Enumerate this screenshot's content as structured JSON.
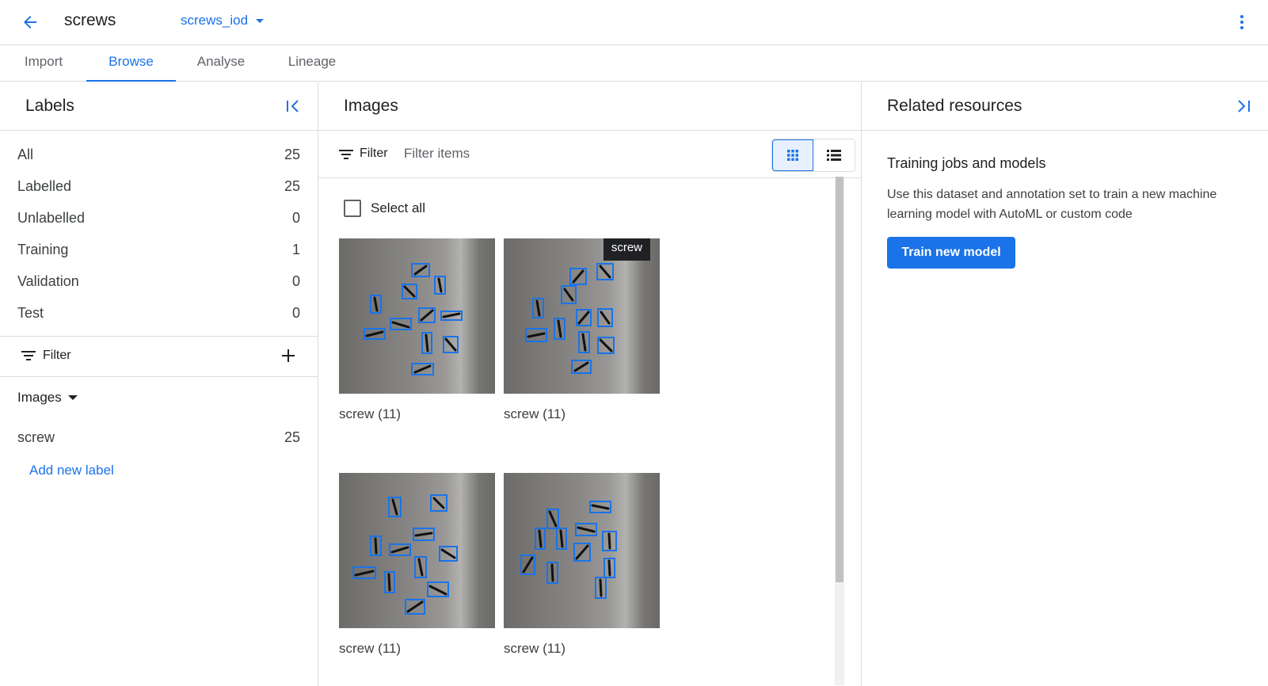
{
  "topbar": {
    "back_icon": "arrow-back-icon",
    "dataset_name": "screws",
    "annotation_set": "screws_iod",
    "more_icon": "more-vert-icon"
  },
  "tabs": [
    {
      "label": "Import",
      "active": false
    },
    {
      "label": "Browse",
      "active": true
    },
    {
      "label": "Analyse",
      "active": false
    },
    {
      "label": "Lineage",
      "active": false
    }
  ],
  "labels_panel": {
    "title": "Labels",
    "collapse_icon": "collapse-left-icon",
    "items": [
      {
        "name": "All",
        "count": "25"
      },
      {
        "name": "Labelled",
        "count": "25"
      },
      {
        "name": "Unlabelled",
        "count": "0"
      },
      {
        "name": "Training",
        "count": "1"
      },
      {
        "name": "Validation",
        "count": "0"
      },
      {
        "name": "Test",
        "count": "0"
      }
    ],
    "filter_label": "Filter",
    "group_label": "Images",
    "label_items": [
      {
        "name": "screw",
        "count": "25"
      }
    ],
    "add_label": "Add new label"
  },
  "images_panel": {
    "title": "Images",
    "filter_label": "Filter",
    "filter_placeholder": "Filter items",
    "select_all": "Select all",
    "tiles": [
      {
        "caption": "screw (11)",
        "tooltip": ""
      },
      {
        "caption": "screw (11)",
        "tooltip": "screw"
      },
      {
        "caption": "screw (11)",
        "tooltip": ""
      },
      {
        "caption": "screw (11)",
        "tooltip": ""
      }
    ]
  },
  "related_panel": {
    "title": "Related resources",
    "expand_icon": "collapse-right-icon",
    "section_title": "Training jobs and models",
    "description": "Use this dataset and annotation set to train a new machine learning model with AutoML or custom code",
    "train_button": "Train new model"
  },
  "colors": {
    "accent": "#1a73e8",
    "bbox": "#1a73e8",
    "divider": "#dadce0"
  }
}
